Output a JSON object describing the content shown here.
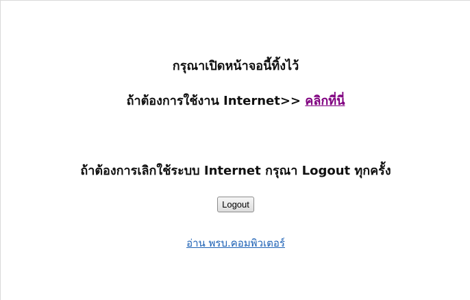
{
  "message": {
    "keep_open": "กรุณาเปิดหน้าจอนี้ทิ้งไว้",
    "internet_prefix": "ถ้าต้องการใช้งาน Internet>> ",
    "click_here_link": "คลิกที่นี่",
    "logout_prompt": "ถ้าต้องการเลิกใช้ระบบ Internet กรุณา Logout ทุกครั้ง"
  },
  "form": {
    "logout_button": "Logout"
  },
  "footer": {
    "computer_act_link": "อ่าน พรบ.คอมพิวเตอร์"
  }
}
